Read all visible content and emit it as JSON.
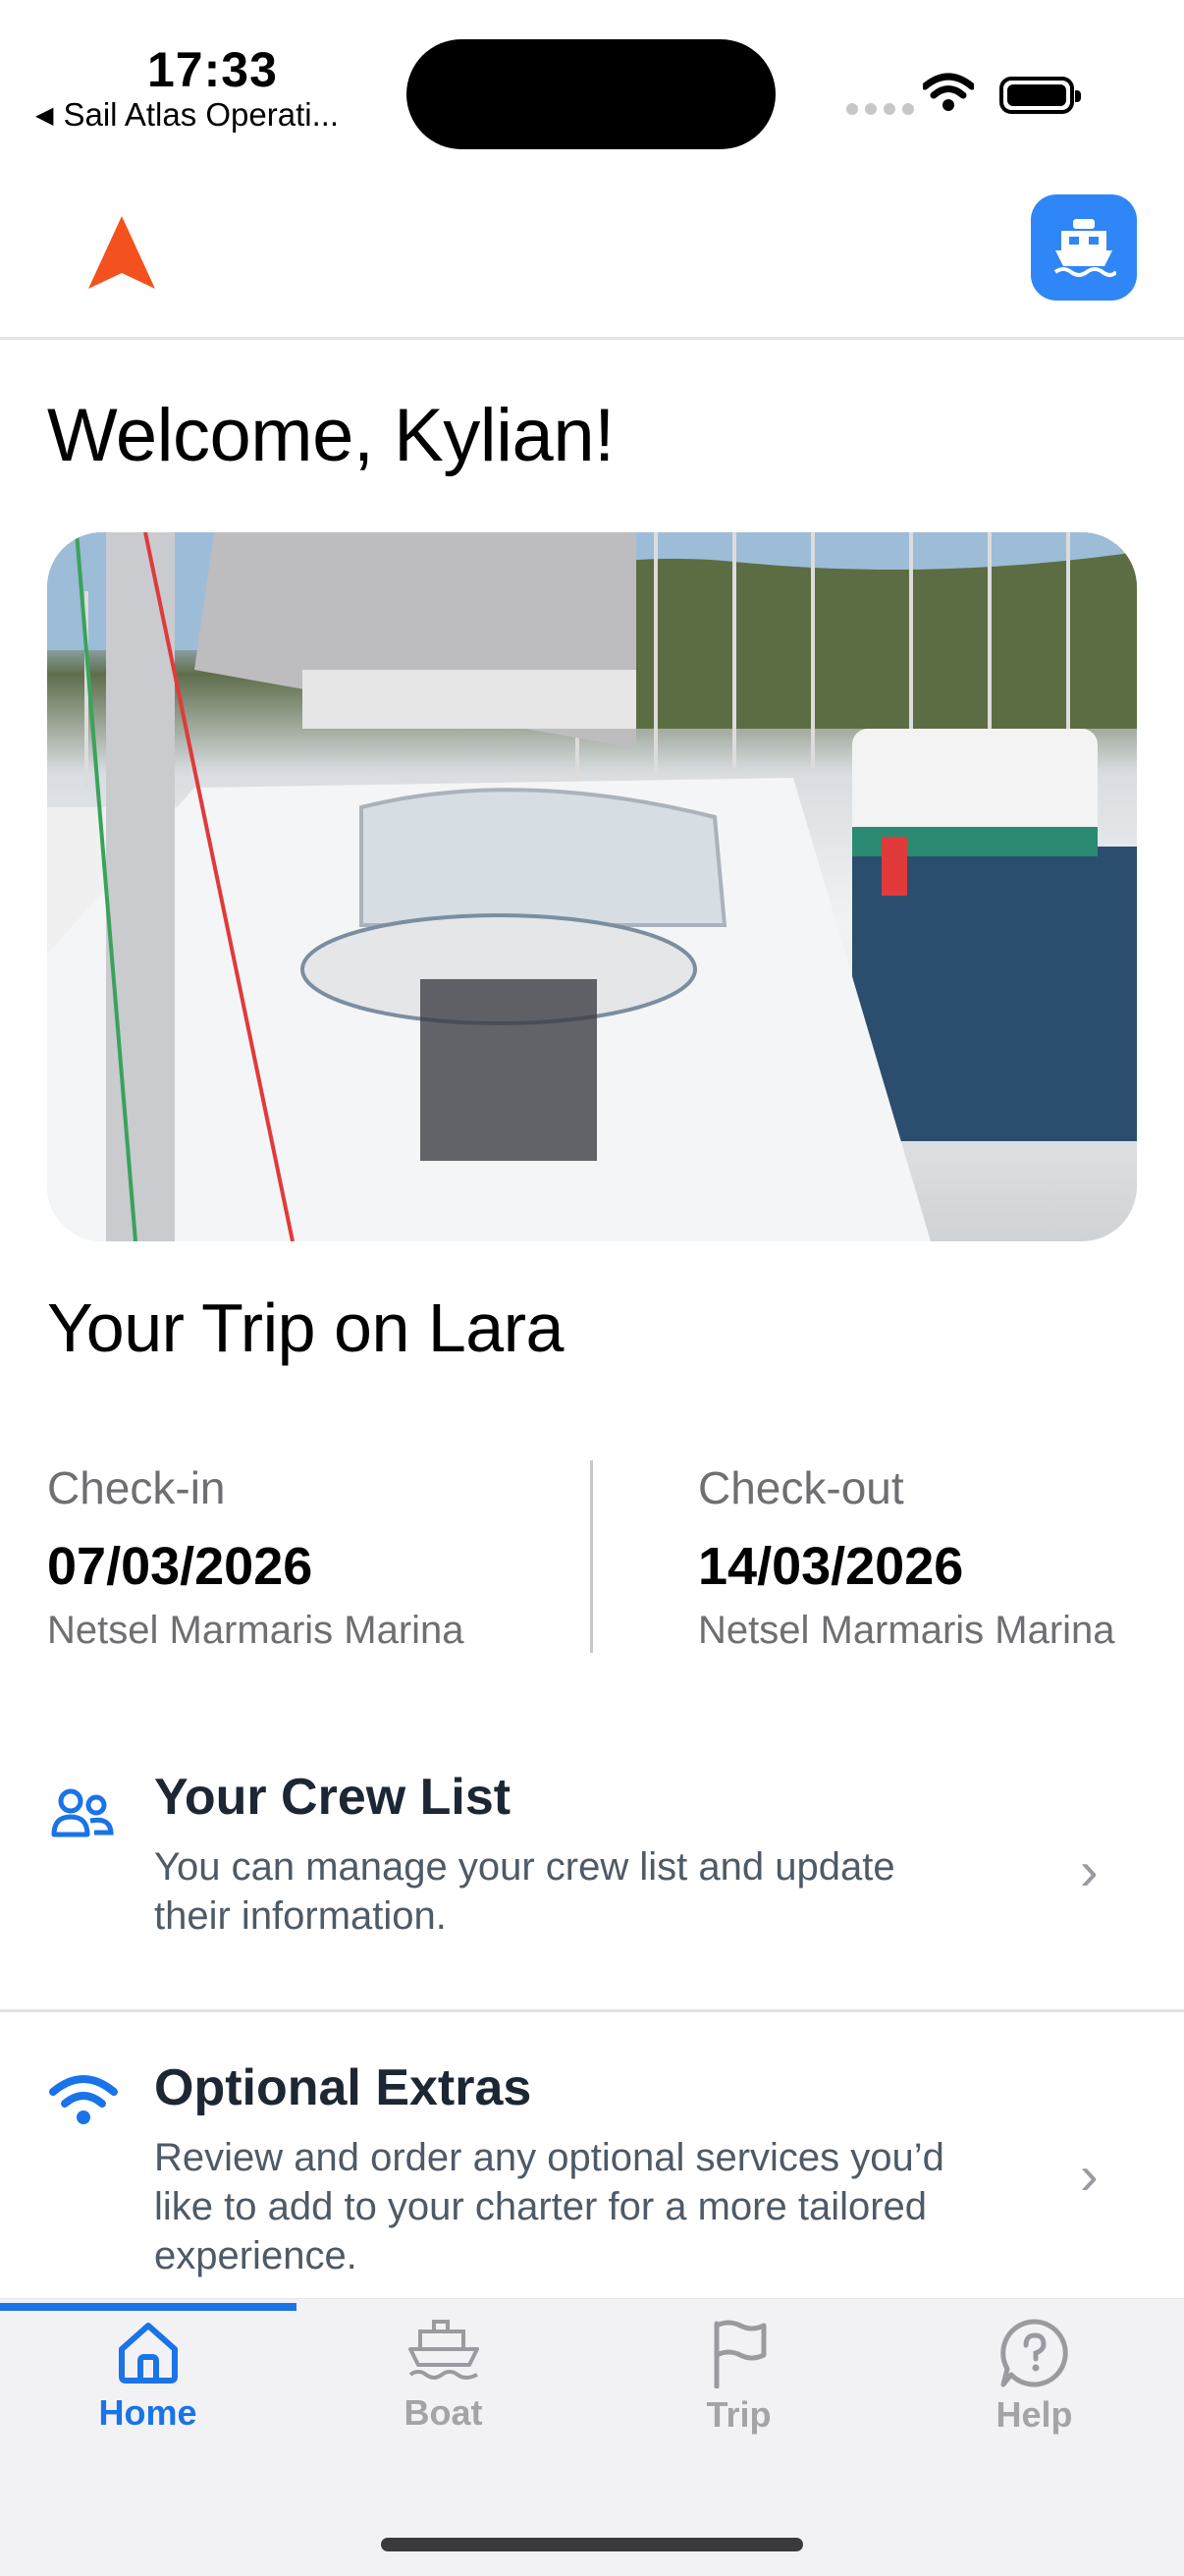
{
  "status_bar": {
    "time": "17:33",
    "back_app": "Sail Atlas Operati..."
  },
  "header": {
    "boat_button_icon": "ship-icon",
    "logo_icon": "navigation-arrow-icon"
  },
  "welcome": "Welcome, Kylian!",
  "trip": {
    "title": "Your Trip on Lara",
    "check_in": {
      "label": "Check-in",
      "date": "07/03/2026",
      "place": "Netsel Marmaris Marina"
    },
    "check_out": {
      "label": "Check-out",
      "date": "14/03/2026",
      "place": "Netsel Marmaris Marina"
    }
  },
  "rows": [
    {
      "title": "Your Crew List",
      "desc_line1": "You can manage your crew list and update",
      "desc_line2": "their information.",
      "icon": "crew-icon"
    },
    {
      "title": "Optional Extras",
      "desc_line1": "Review and order any optional services you’d",
      "desc_line2": "like to add to your charter for a more tailored",
      "desc_line3": "experience.",
      "icon": "wifi-icon"
    }
  ],
  "tabs": [
    {
      "label": "Home",
      "icon": "home-icon",
      "active": true
    },
    {
      "label": "Boat",
      "icon": "boat-icon"
    },
    {
      "label": "Trip",
      "icon": "flag-icon"
    },
    {
      "label": "Help",
      "icon": "help-icon"
    }
  ],
  "colors": {
    "accent": "#1a73e8",
    "logo": "#f4511e",
    "boat_button": "#2f86f6"
  }
}
